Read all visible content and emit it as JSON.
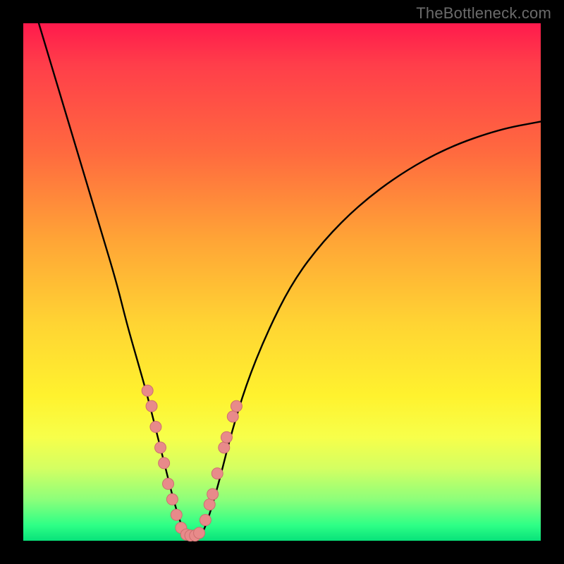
{
  "attribution": "TheBottleneck.com",
  "colors": {
    "frame": "#000000",
    "curve": "#000000",
    "marker_fill": "#e88a8a",
    "marker_stroke": "#cc6f6f"
  },
  "chart_data": {
    "type": "line",
    "title": "",
    "xlabel": "",
    "ylabel": "",
    "xlim": [
      0,
      100
    ],
    "ylim": [
      0,
      100
    ],
    "series": [
      {
        "name": "bottleneck-curve",
        "x": [
          3,
          6,
          9,
          12,
          15,
          18,
          20,
          22,
          24,
          26,
          27.5,
          29,
          30.5,
          32,
          33,
          34.5,
          36,
          38,
          40,
          43,
          47,
          52,
          58,
          65,
          73,
          82,
          92,
          100
        ],
        "y": [
          100,
          90,
          80,
          70,
          60,
          50,
          42,
          35,
          28,
          20,
          14,
          8,
          3,
          0,
          0,
          1,
          5,
          12,
          20,
          30,
          40,
          50,
          58,
          65,
          71,
          76,
          79.5,
          81
        ]
      }
    ],
    "markers": {
      "name": "highlight-points",
      "points": [
        {
          "x": 24.0,
          "y": 29
        },
        {
          "x": 24.8,
          "y": 26
        },
        {
          "x": 25.6,
          "y": 22
        },
        {
          "x": 26.5,
          "y": 18
        },
        {
          "x": 27.2,
          "y": 15
        },
        {
          "x": 28.0,
          "y": 11
        },
        {
          "x": 28.8,
          "y": 8
        },
        {
          "x": 29.6,
          "y": 5
        },
        {
          "x": 30.5,
          "y": 2.5
        },
        {
          "x": 31.5,
          "y": 1.2
        },
        {
          "x": 32.3,
          "y": 1.0
        },
        {
          "x": 33.2,
          "y": 1.0
        },
        {
          "x": 34.0,
          "y": 1.5
        },
        {
          "x": 35.2,
          "y": 4
        },
        {
          "x": 36.0,
          "y": 7
        },
        {
          "x": 36.6,
          "y": 9
        },
        {
          "x": 37.5,
          "y": 13
        },
        {
          "x": 38.8,
          "y": 18
        },
        {
          "x": 39.3,
          "y": 20
        },
        {
          "x": 40.5,
          "y": 24
        },
        {
          "x": 41.2,
          "y": 26
        }
      ]
    }
  }
}
